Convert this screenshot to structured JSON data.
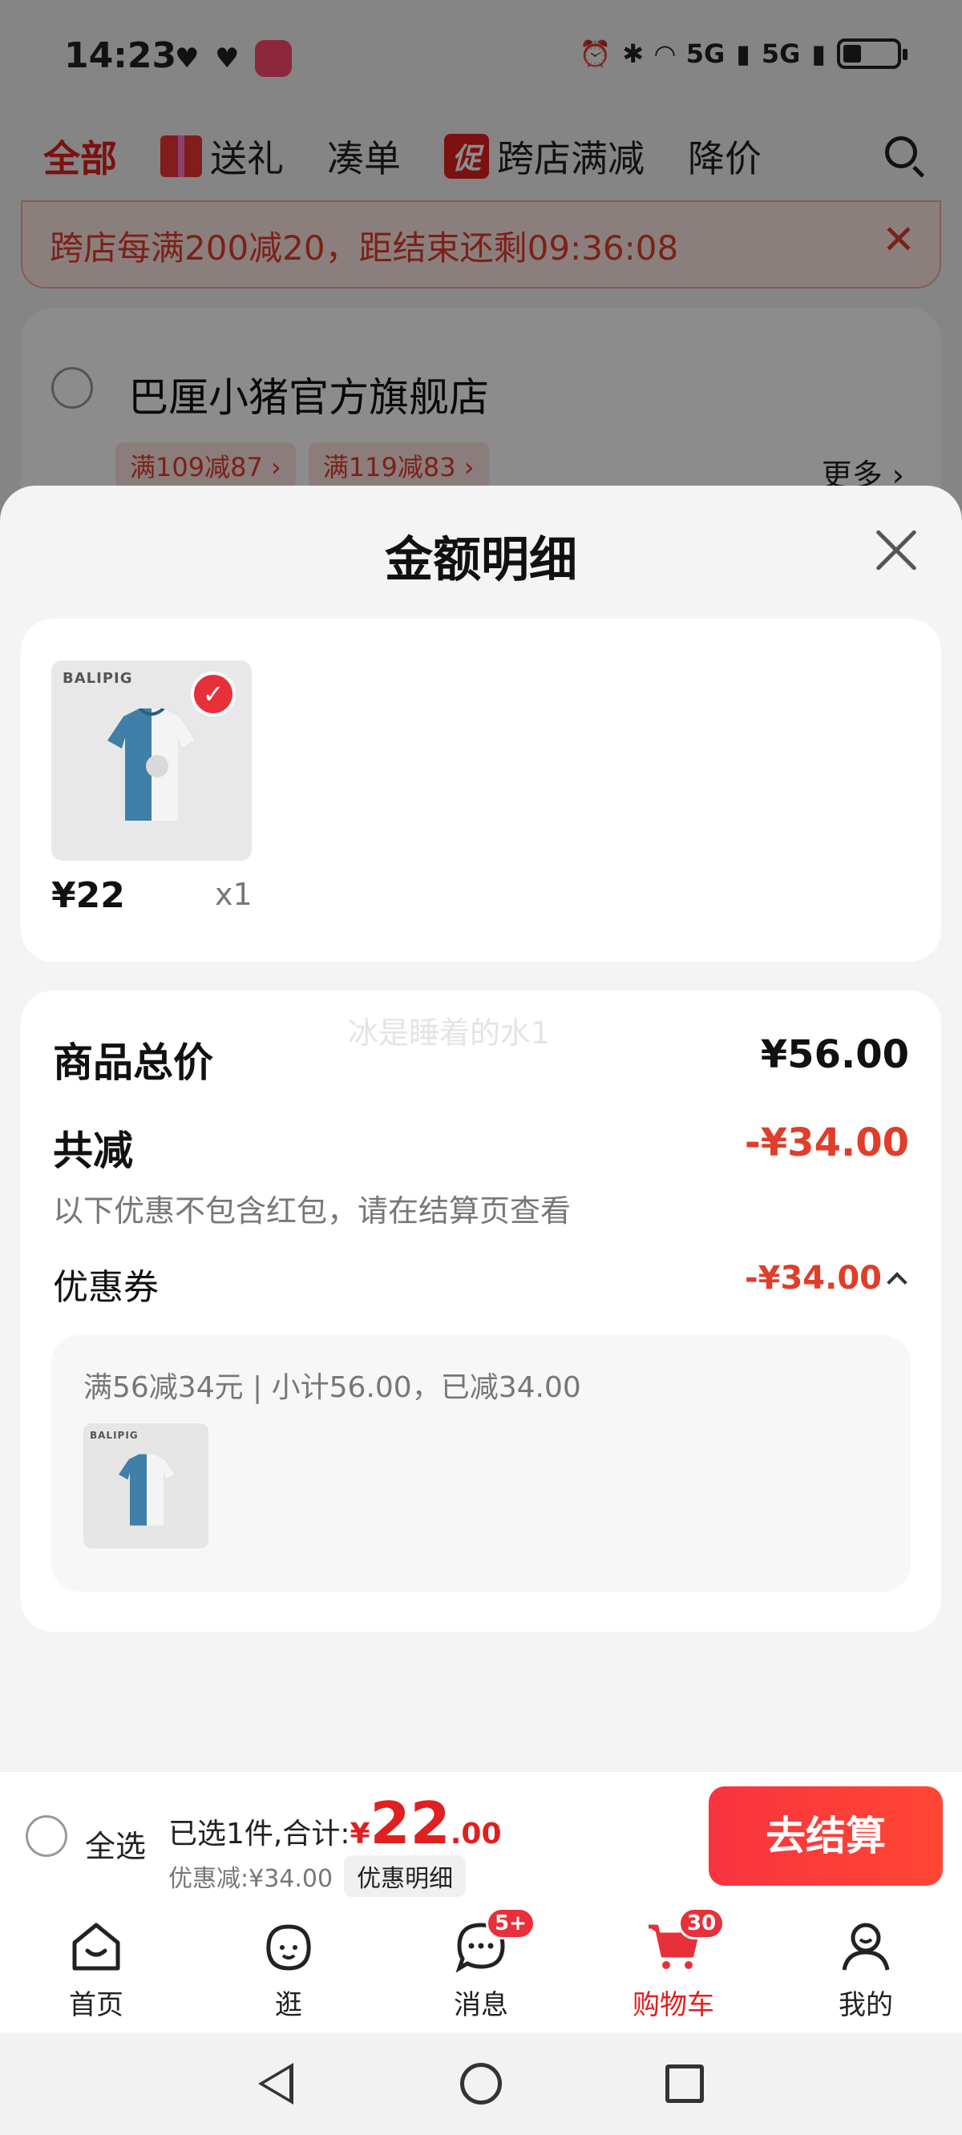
{
  "status_bar": {
    "time": "14:23",
    "network": "5G",
    "network2": "5G"
  },
  "top_tabs": [
    {
      "label": "全部",
      "active": true
    },
    {
      "label": "送礼",
      "icon": "gift-icon"
    },
    {
      "label": "凑单"
    },
    {
      "label": "跨店满减",
      "chip": "促"
    },
    {
      "label": "降价"
    }
  ],
  "promo_banner": {
    "text": "跨店每满200减20，距结束还剩09:36:08"
  },
  "store": {
    "name": "巴厘小猪官方旗舰店",
    "coupons": [
      "满109减87 ›",
      "满119减83 ›"
    ],
    "more": "更多 ›"
  },
  "sheet": {
    "title": "金额明细",
    "item": {
      "brand": "BALIPIG",
      "price": "¥22",
      "qty": "x1"
    },
    "watermark": "冰是睡着的水1",
    "total_label": "商品总价",
    "total_value": "¥56.00",
    "reduce_label": "共减",
    "reduce_value": "-¥34.00",
    "reduce_note": "以下优惠不包含红包，请在结算页查看",
    "coupon_label": "优惠券",
    "coupon_value": "-¥34.00",
    "coupon_desc": "满56减34元 | 小计56.00，已减34.00"
  },
  "checkout": {
    "select_all": "全选",
    "summary_prefix": "已选1件,合计:",
    "price_symbol": "¥",
    "price_int": "22",
    "price_dec": ".00",
    "discount_text": "优惠减:¥34.00",
    "detail_chip": "优惠明细",
    "button": "去结算"
  },
  "tab_bar": [
    {
      "label": "首页",
      "icon": "home-icon"
    },
    {
      "label": "逛",
      "icon": "browse-icon"
    },
    {
      "label": "消息",
      "icon": "message-icon",
      "badge": "5+"
    },
    {
      "label": "购物车",
      "icon": "cart-icon",
      "badge": "30",
      "active": true
    },
    {
      "label": "我的",
      "icon": "profile-icon"
    }
  ],
  "colors": {
    "accent": "#e02020",
    "checkout_button": "#f8343f",
    "promo_text": "#e03d2a"
  }
}
